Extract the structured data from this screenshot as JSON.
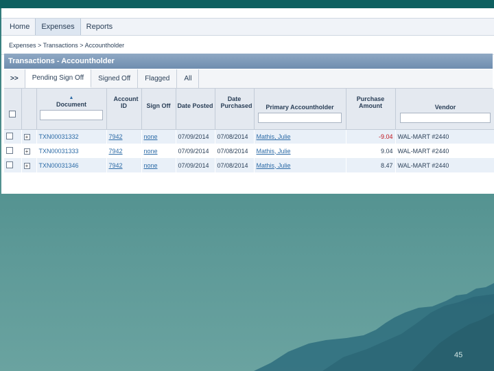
{
  "nav": {
    "items": [
      "Home",
      "Expenses",
      "Reports"
    ],
    "active_index": 1
  },
  "breadcrumb": "Expenses > Transactions > Accountholder",
  "panel": {
    "title": "Transactions - Accountholder"
  },
  "tabs": {
    "expand": ">>",
    "items": [
      "Pending Sign Off",
      "Signed Off",
      "Flagged",
      "All"
    ],
    "active_index": 0
  },
  "table": {
    "headers": {
      "document": "Document",
      "account_id": "Account ID",
      "sign_off": "Sign Off",
      "date_posted": "Date Posted",
      "date_purchased": "Date Purchased",
      "primary_accountholder": "Primary Accountholder",
      "purchase_amount": "Purchase Amount",
      "vendor": "Vendor"
    },
    "rows": [
      {
        "document": "TXN00031332",
        "account_id": "7942",
        "sign_off": "none",
        "date_posted": "07/09/2014",
        "date_purchased": "07/08/2014",
        "accountholder": "Mathis, Julie",
        "amount": "-9.04",
        "vendor": "WAL-MART #2440"
      },
      {
        "document": "TXN00031333",
        "account_id": "7942",
        "sign_off": "none",
        "date_posted": "07/09/2014",
        "date_purchased": "07/08/2014",
        "accountholder": "Mathis, Julie",
        "amount": "9.04",
        "vendor": "WAL-MART #2440"
      },
      {
        "document": "TXN00031346",
        "account_id": "7942",
        "sign_off": "none",
        "date_posted": "07/09/2014",
        "date_purchased": "07/08/2014",
        "accountholder": "Mathis, Julie",
        "amount": "8.47",
        "vendor": "WAL-MART #2440"
      }
    ]
  },
  "slide": {
    "page_number": "45"
  },
  "colors": {
    "accent": "#2b6aa6",
    "negative": "#c0141e",
    "header_bar": "#6f8daf",
    "background": "#4b8c8a"
  }
}
